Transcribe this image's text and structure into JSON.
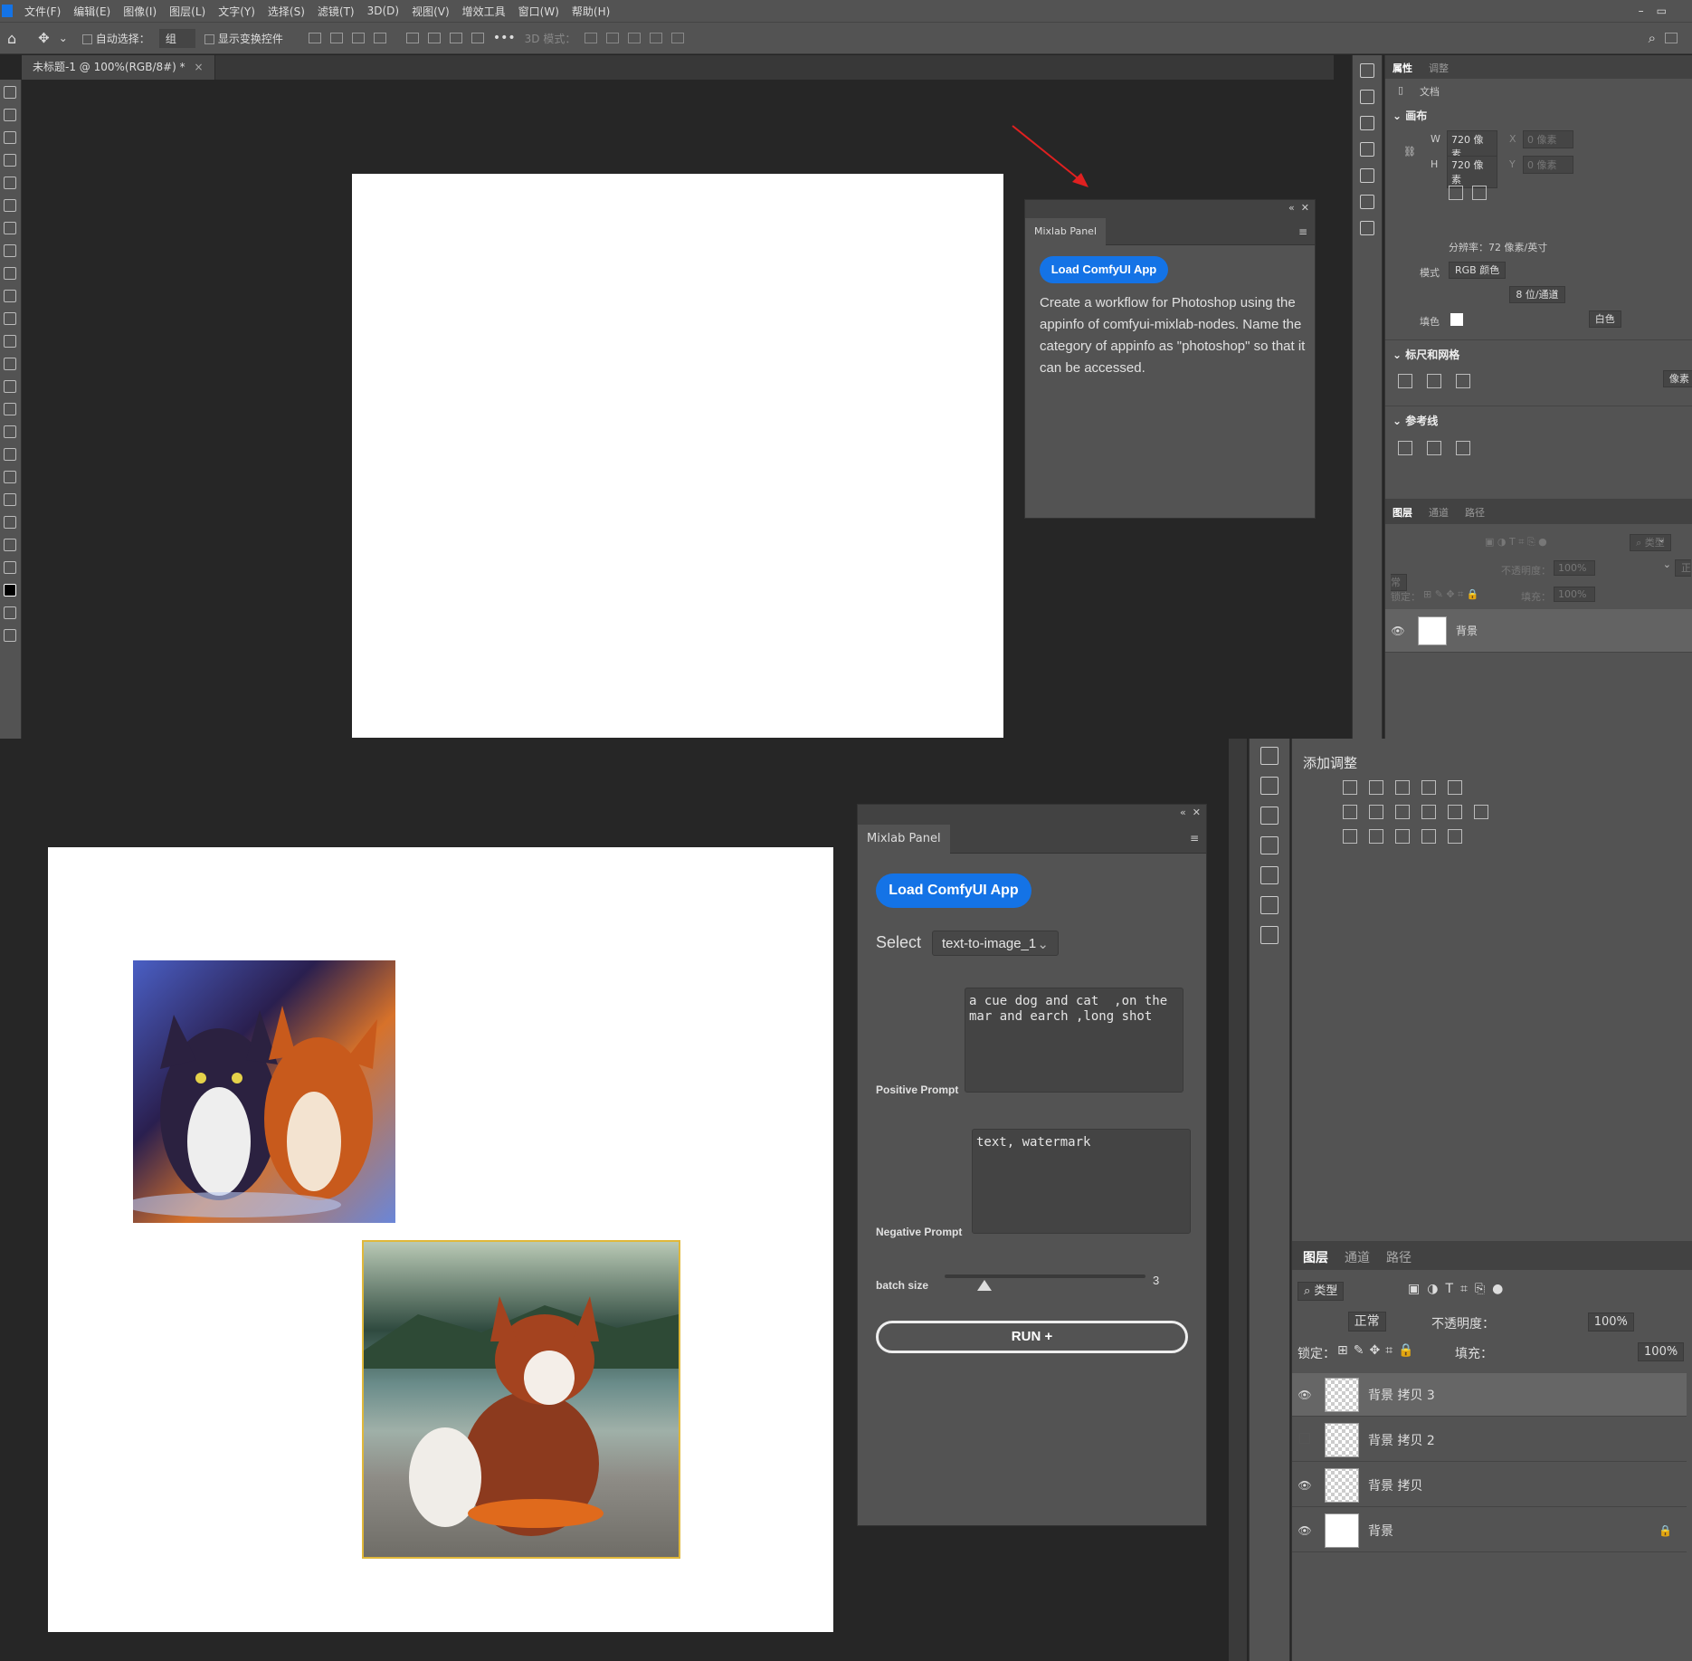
{
  "menubar": {
    "items": [
      "文件(F)",
      "编辑(E)",
      "图像(I)",
      "图层(L)",
      "文字(Y)",
      "选择(S)",
      "滤镜(T)",
      "3D(D)",
      "视图(V)",
      "增效工具",
      "窗口(W)",
      "帮助(H)"
    ]
  },
  "options_bar": {
    "auto_select_label": "自动选择：",
    "auto_select_value": "组",
    "show_transform_label": "显示变换控件",
    "three_d_mode_label": "3D 模式："
  },
  "document_tab": {
    "title": "未标题-1 @ 100%(RGB/8#) *",
    "close": "×"
  },
  "mixlab_top": {
    "tab": "Mixlab Panel",
    "load_button": "Load ComfyUI App",
    "description": "Create a workflow for Photoshop using the appinfo of comfyui-mixlab-nodes. Name the category of appinfo as \"photoshop\" so that it can be accessed."
  },
  "mixlab_bottom": {
    "tab": "Mixlab Panel",
    "load_button": "Load ComfyUI App",
    "select_label": "Select",
    "select_value": "text-to-image_1",
    "positive_prompt_value": "a cue dog and cat  ,on the mar and earch ,long shot",
    "positive_prompt_label": "Positive Prompt",
    "negative_prompt_value": "text, watermark",
    "negative_prompt_label": "Negative Prompt",
    "batch_size_label": "batch size",
    "batch_size_value": "3",
    "batch_size_fraction": 0.2,
    "run_button": "RUN +"
  },
  "properties_panel": {
    "tabs": [
      "属性",
      "调整"
    ],
    "doc_label": "文档",
    "canvas_section": "画布",
    "w_label": "W",
    "w_value": "720 像素",
    "h_label": "H",
    "h_value": "720 像素",
    "x_label": "X",
    "x_placeholder": "0 像素",
    "y_label": "Y",
    "y_placeholder": "0 像素",
    "resolution": "分辨率：72 像素/英寸",
    "mode_label": "模式",
    "mode_value": "RGB 颜色",
    "bits_value": "8 位/通道",
    "fill_label": "填色",
    "fill_value": "白色",
    "rulers_section": "标尺和网格",
    "units_value": "像素",
    "guides_section": "参考线"
  },
  "layers_top": {
    "tabs": [
      "图层",
      "通道",
      "路径"
    ],
    "filter_label": "类型",
    "blend_mode": "正常",
    "opacity_label": "不透明度：",
    "opacity_value": "100%",
    "lock_label": "锁定：",
    "fill_label": "填充：",
    "fill_value": "100%",
    "layers": [
      {
        "name": "背景"
      }
    ]
  },
  "adjustments_panel": {
    "title": "添加调整"
  },
  "layers_bottom": {
    "tabs": [
      "图层",
      "通道",
      "路径"
    ],
    "filter_label": "类型",
    "blend_mode": "正常",
    "opacity_label": "不透明度：",
    "opacity_value": "100%",
    "lock_label": "锁定：",
    "fill_label": "填充：",
    "fill_value": "100%",
    "layers": [
      {
        "name": "背景 拷贝 3"
      },
      {
        "name": "背景 拷贝 2"
      },
      {
        "name": "背景 拷贝"
      },
      {
        "name": "背景"
      }
    ]
  },
  "colors": {
    "accent": "#1473e6",
    "panel_bg": "#535353",
    "workspace": "#262626",
    "arrow": "#e02020"
  }
}
